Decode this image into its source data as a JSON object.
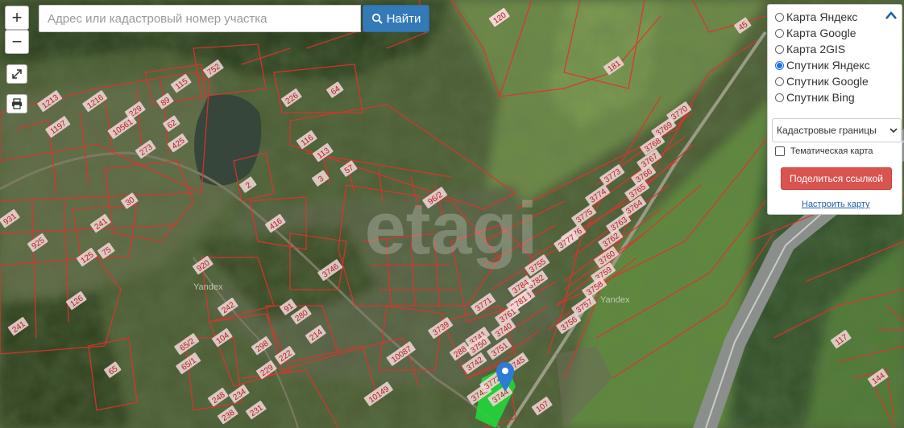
{
  "search": {
    "placeholder": "Адрес или кадастровый номер участка",
    "button_label": "Найти"
  },
  "map_controls": {
    "zoom_in": "+",
    "zoom_out": "−"
  },
  "layers": {
    "options": [
      {
        "label": "Карта Яндекс",
        "selected": false
      },
      {
        "label": "Карта Google",
        "selected": false
      },
      {
        "label": "Карта 2GIS",
        "selected": false
      },
      {
        "label": "Спутник Яндекс",
        "selected": true
      },
      {
        "label": "Спутник Google",
        "selected": false
      },
      {
        "label": "Спутник Bing",
        "selected": false
      }
    ],
    "overlay_select": "Кадастровые границы",
    "thematic_label": "Тематическая карта",
    "share_label": "Поделиться ссылкой",
    "settings_label": "Настроить карту"
  },
  "map": {
    "watermark": "etagi",
    "provider_labels": [
      "Yandex",
      "Yandex"
    ],
    "plot_labels": [
      "181",
      "45",
      "181",
      "752",
      "115",
      "64",
      "226",
      "89",
      "1213",
      "1216",
      "229",
      "1197",
      "10561",
      "62",
      "273",
      "425",
      "116",
      "113",
      "57",
      "3",
      "2",
      "96/2",
      "30",
      "241",
      "416",
      "125",
      "126",
      "75",
      "931",
      "925",
      "241",
      "920",
      "242",
      "65/2",
      "91",
      "280",
      "214",
      "104",
      "65/1",
      "65",
      "298",
      "222",
      "229",
      "234",
      "248",
      "231",
      "238",
      "3770",
      "3769",
      "3768",
      "3767",
      "3766",
      "3765",
      "3764",
      "3773",
      "3774",
      "3775",
      "3776",
      "3777",
      "3763",
      "3762",
      "3760",
      "3759",
      "3758",
      "3757",
      "3756",
      "3755",
      "3782",
      "3783",
      "3784",
      "3781",
      "3740",
      "3741",
      "3742",
      "3743",
      "3745",
      "3739",
      "10087",
      "107",
      "117",
      "144",
      "288",
      "3750",
      "3751",
      "3761",
      "3771",
      "3772",
      "3744",
      "3746",
      "10149",
      "120"
    ],
    "colors": {
      "boundary": "#e0322e",
      "label_bg": "#f4d9d9",
      "highlight": "#22d63a",
      "marker": "#2e7bd6"
    }
  }
}
